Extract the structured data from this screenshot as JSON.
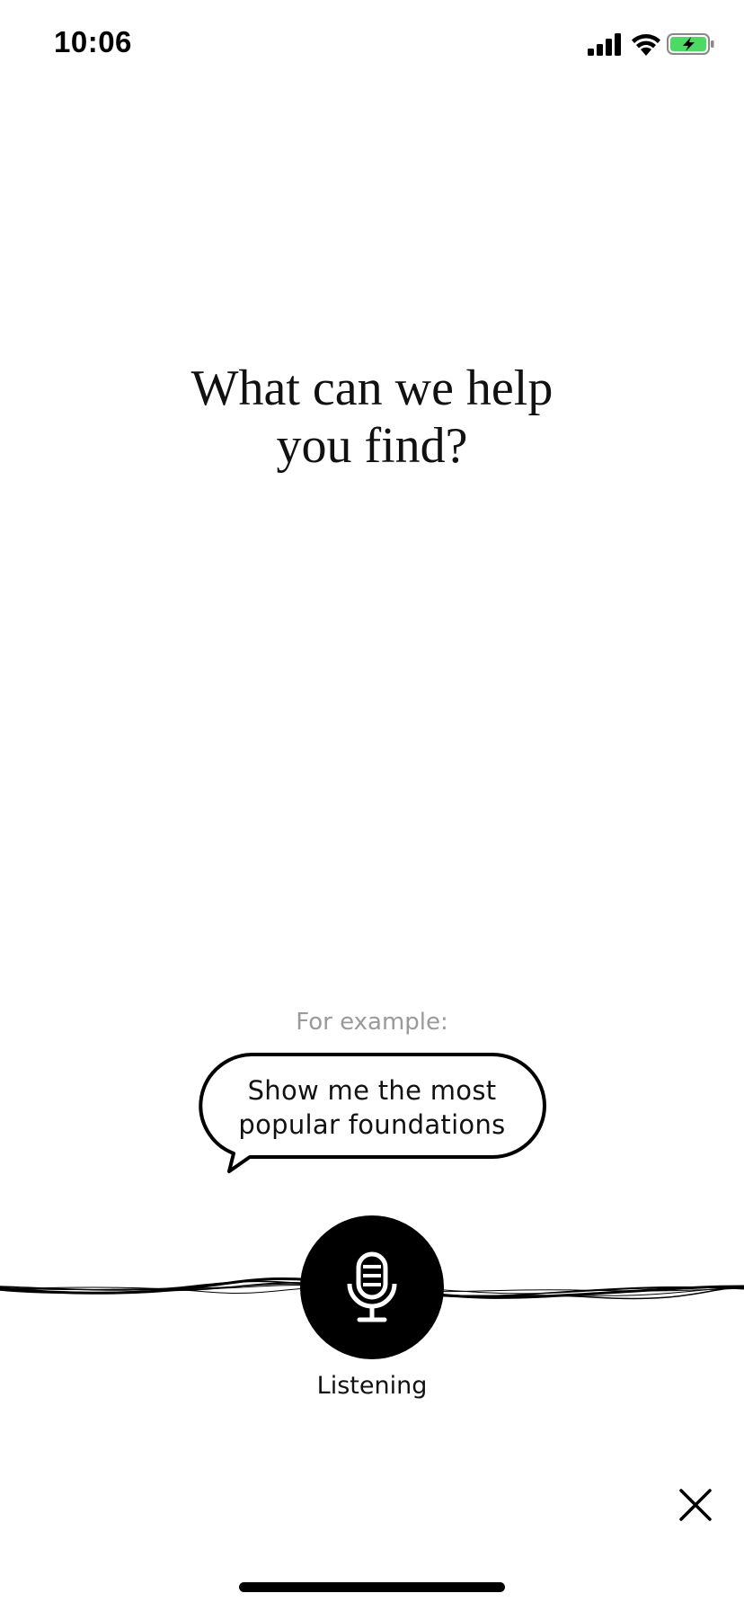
{
  "status_bar": {
    "time": "10:06",
    "icons": [
      "cellular-signal-icon",
      "wifi-icon",
      "battery-charging-icon"
    ],
    "battery_color": "#4cd964"
  },
  "headline": {
    "line1": "What can we help",
    "line2": "you find?"
  },
  "example": {
    "label": "For example:",
    "suggestion_line1": "Show me the most",
    "suggestion_line2": "popular foundations"
  },
  "voice": {
    "icon": "microphone-icon",
    "status": "Listening"
  },
  "close": {
    "icon": "close-icon"
  }
}
